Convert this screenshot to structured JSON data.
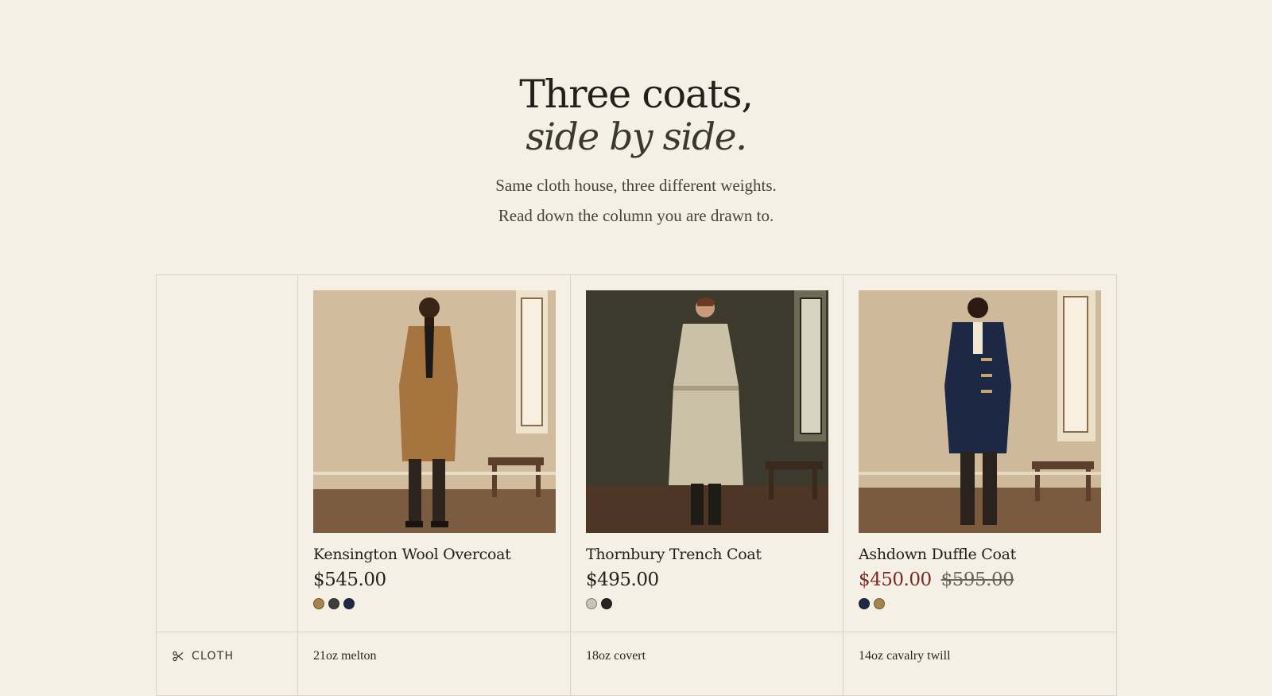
{
  "hero": {
    "title_line1": "Three coats,",
    "title_line2": "side by side.",
    "sub_line1": "Same cloth house, three different weights.",
    "sub_line2": "Read down the column you are drawn to."
  },
  "products": [
    {
      "name": "Kensington Wool Overcoat",
      "price": "$545.00",
      "original_price": "",
      "on_sale": false,
      "swatches": [
        "#a9834f",
        "#3d3f3c",
        "#1f2a47"
      ],
      "coat_color": "#a5743f",
      "wall_color": "#d2bc9e",
      "cloth": "21oz melton"
    },
    {
      "name": "Thornbury Trench Coat",
      "price": "$495.00",
      "original_price": "",
      "on_sale": false,
      "swatches": [
        "#c9c3b6",
        "#252423"
      ],
      "coat_color": "#cbc0a8",
      "wall_color": "#3c3a2c",
      "cloth": "18oz covert"
    },
    {
      "name": "Ashdown Duffle Coat",
      "price": "$450.00",
      "original_price": "$595.00",
      "on_sale": true,
      "swatches": [
        "#1f2a47",
        "#a9834f"
      ],
      "coat_color": "#1d2944",
      "wall_color": "#cfb99b",
      "cloth": "14oz cavalry twill"
    }
  ],
  "rows": {
    "cloth_label": "CLOTH",
    "cloth_icon": "scissors-icon"
  },
  "colors": {
    "background": "#f5f0e6",
    "border": "#ddd3c4",
    "sale": "#7a2a22"
  }
}
